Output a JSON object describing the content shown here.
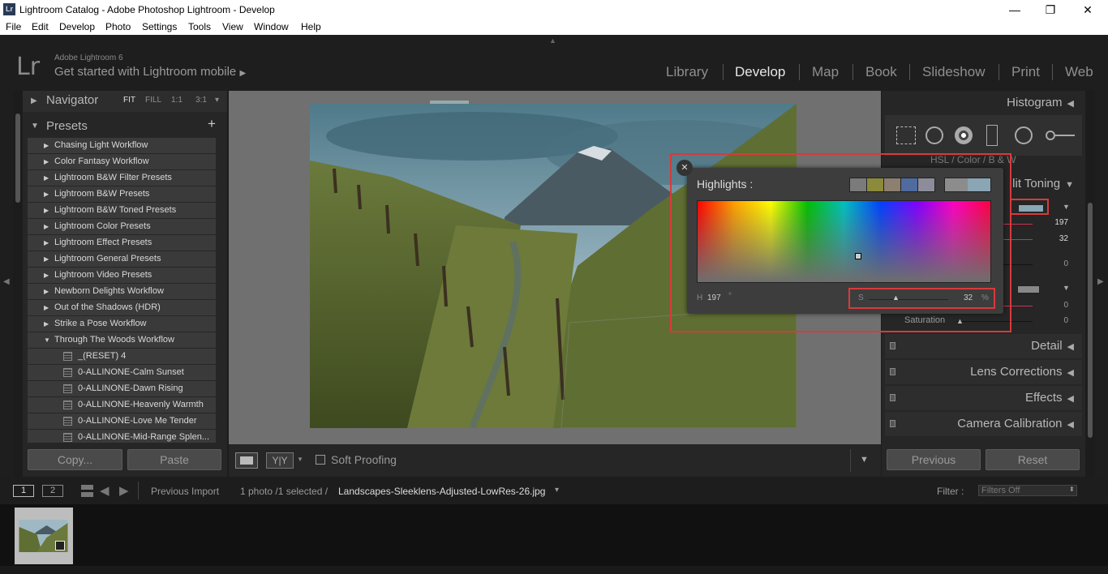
{
  "window": {
    "title": "Lightroom Catalog - Adobe Photoshop Lightroom - Develop",
    "app_icon": "Lr",
    "minimize": "—",
    "restore": "❐",
    "close": "✕"
  },
  "menu": [
    "File",
    "Edit",
    "Develop",
    "Photo",
    "Settings",
    "Tools",
    "View",
    "Window",
    "Help"
  ],
  "identity": {
    "logo": "Lr",
    "product": "Adobe Lightroom 6",
    "cta": "Get started with Lightroom mobile",
    "cta_arrow": "▶"
  },
  "modules": [
    "Library",
    "Develop",
    "Map",
    "Book",
    "Slideshow",
    "Print",
    "Web"
  ],
  "active_module": "Develop",
  "navigator": {
    "title": "Navigator",
    "options": [
      "FIT",
      "FILL",
      "1:1",
      "3:1"
    ],
    "menu": "▾"
  },
  "presets": {
    "title": "Presets",
    "add": "+",
    "folders": [
      "Chasing Light Workflow",
      "Color Fantasy Workflow",
      "Lightroom B&W Filter Presets",
      "Lightroom B&W Presets",
      "Lightroom B&W Toned Presets",
      "Lightroom Color Presets",
      "Lightroom Effect Presets",
      "Lightroom General Presets",
      "Lightroom Video Presets",
      "Newborn Delights Workflow",
      "Out of the Shadows (HDR)",
      "Strike a Pose Workflow"
    ],
    "open_folder": "Through The Woods Workflow",
    "items": [
      "_(RESET) 4",
      "0-ALLINONE-Calm Sunset",
      "0-ALLINONE-Dawn Rising",
      "0-ALLINONE-Heavenly Warmth",
      "0-ALLINONE-Love Me Tender",
      "0-ALLINONE-Mid-Range Splen..."
    ]
  },
  "left_buttons": {
    "copy": "Copy...",
    "paste": "Paste"
  },
  "toolbar": {
    "soft_proofing": "Soft Proofing",
    "yy": "Y|Y"
  },
  "right": {
    "histogram": "Histogram",
    "hsl_tabs": "HSL / Color / B & W",
    "split_toning": "Split Toning",
    "split_toning_partial": "lit Toning",
    "hue_value": "197",
    "sat_value": "32",
    "balance": "0",
    "shadows_hue": "0",
    "shadows_sat": "0",
    "saturation_label": "Saturation",
    "detail": "Detail",
    "lens": "Lens Corrections",
    "effects": "Effects",
    "calibration": "Camera Calibration",
    "previous": "Previous",
    "reset": "Reset"
  },
  "popup": {
    "title": "Highlights :",
    "h_label": "H",
    "h_value": "197",
    "deg": "°",
    "s_label": "S",
    "s_value": "32",
    "pct": "%",
    "swatches": [
      "#7b7b7b",
      "#8c8a3c",
      "#8d8070",
      "#4f6b9f",
      "#8c8c9a"
    ],
    "current_swatch": "#8aa5b4",
    "close": "✕"
  },
  "filmbar": {
    "view1": "1",
    "view2": "2",
    "source": "Previous Import",
    "count": "1 photo /1 selected /",
    "filename": "Landscapes-Sleeklens-Adjusted-LowRes-26.jpg",
    "filename_menu": "▾",
    "filter_label": "Filter :",
    "filter_value": "Filters Off"
  },
  "colors": {
    "accent_red": "#d83a3a",
    "panel": "#262626",
    "popup": "#3d3d3d"
  }
}
